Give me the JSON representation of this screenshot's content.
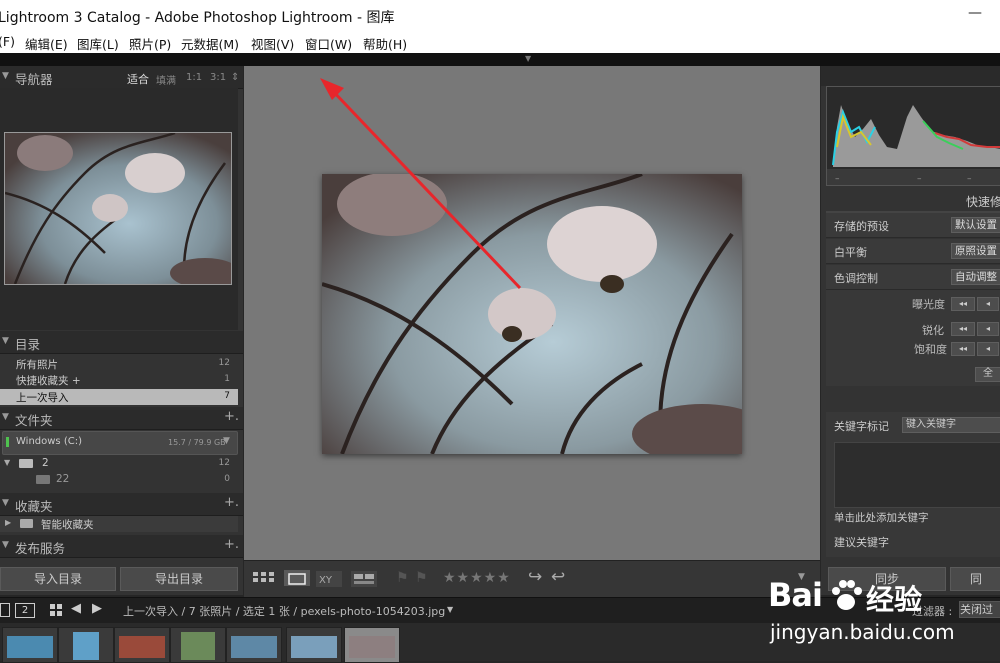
{
  "window": {
    "title": "Lightroom 3 Catalog - Adobe Photoshop Lightroom - 图库",
    "minimize": "—"
  },
  "menu": [
    "(F)",
    "编辑(E)",
    "图库(L)",
    "照片(P)",
    "元数据(M)",
    "视图(V)",
    "窗口(W)",
    "帮助(H)"
  ],
  "navigator": {
    "title": "导航器",
    "options": [
      "适合",
      "填满",
      "1:1",
      "3:1"
    ]
  },
  "catalog": {
    "title": "目录",
    "rows": [
      {
        "label": "所有照片",
        "count": "12"
      },
      {
        "label": "快捷收藏夹 +",
        "count": "1"
      },
      {
        "label": "上一次导入",
        "count": "7"
      }
    ]
  },
  "folders": {
    "title": "文件夹",
    "drive": {
      "name": "Windows (C:)",
      "size": "15.7 / 79.9 GB"
    },
    "rows": [
      {
        "label": "2",
        "count": "12"
      },
      {
        "label": "22",
        "count": "0"
      }
    ]
  },
  "collections": {
    "title": "收藏夹",
    "rows": [
      {
        "label": "智能收藏夹"
      }
    ]
  },
  "publish": {
    "title": "发布服务"
  },
  "buttons": {
    "import": "导入目录",
    "export": "导出目录"
  },
  "toolbar": {
    "stars": "★★★★★"
  },
  "right": {
    "quick_dev_title": "快速修",
    "rows": [
      {
        "label": "存储的预设",
        "value": "默认设置"
      },
      {
        "label": "白平衡",
        "value": "原照设置"
      },
      {
        "label": "色调控制",
        "value": "自动调整"
      }
    ],
    "sub_rows": [
      "曝光度",
      "锐化",
      "饱和度"
    ],
    "all_button": "全",
    "keywords": {
      "label": "关键字标记",
      "input": "键入关键字",
      "hint": "单击此处添加关键字",
      "suggest": "建议关键字"
    },
    "sync": "同步",
    "sync2": "同"
  },
  "filmstrip": {
    "page": "2",
    "breadcrumb": "上一次导入 / 7 张照片 / 选定 1 张 / pexels-photo-1054203.jpg",
    "filter_label": "过滤器 :",
    "filter_value": "关闭过"
  },
  "watermark": {
    "brand": "Bai",
    "brand2": "经验",
    "url": "jingyan.baidu.com"
  },
  "colors": {
    "accent_red": "#e8262b",
    "panel": "#333333",
    "canvas": "#787878"
  }
}
